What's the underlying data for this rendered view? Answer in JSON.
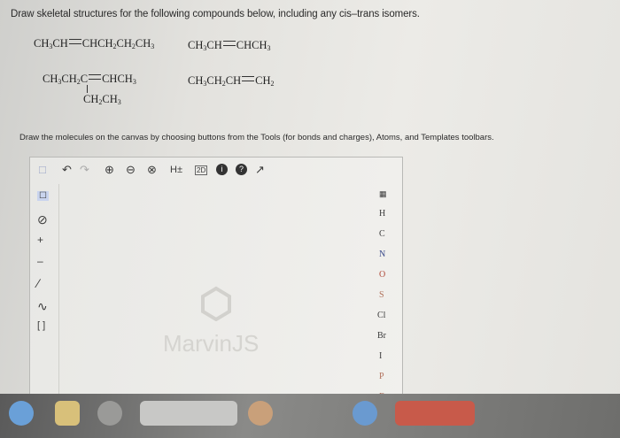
{
  "question": "Draw skeletal structures for the following compounds below, including any cis–trans isomers.",
  "instructions": "Draw the molecules on the canvas by choosing buttons from the Tools (for bonds and charges), Atoms, and Templates toolbars.",
  "compounds": {
    "c1_left": "CH",
    "c1_right": "CHCH",
    "c1_tail": "CH",
    "c1_end": "CH",
    "c2_left": "CH",
    "c2_right": "CHCH",
    "c3_main": "CH",
    "c3_mid": "C",
    "c3_right": "CHCH",
    "c3_branch": "CH",
    "c4_left": "CH",
    "c4_right": "CH"
  },
  "toolbar": {
    "undo": "↶",
    "redo": "↷",
    "zoom_in": "⊕",
    "zoom_out": "⊖",
    "zoom_reset": "⊗",
    "h_toggle": "H±",
    "clean2d": "2D",
    "info": "i",
    "help": "?",
    "fullscreen": "↗"
  },
  "left_tools": {
    "select": "☐",
    "erase": "⊘",
    "plus": "+",
    "minus": "–",
    "single_bond": "∕",
    "chain": "∿",
    "bracket": "[ ]"
  },
  "atoms": [
    "H",
    "C",
    "N",
    "O",
    "S",
    "Cl",
    "Br",
    "I",
    "P",
    "F"
  ],
  "watermark": "MarvinJS"
}
